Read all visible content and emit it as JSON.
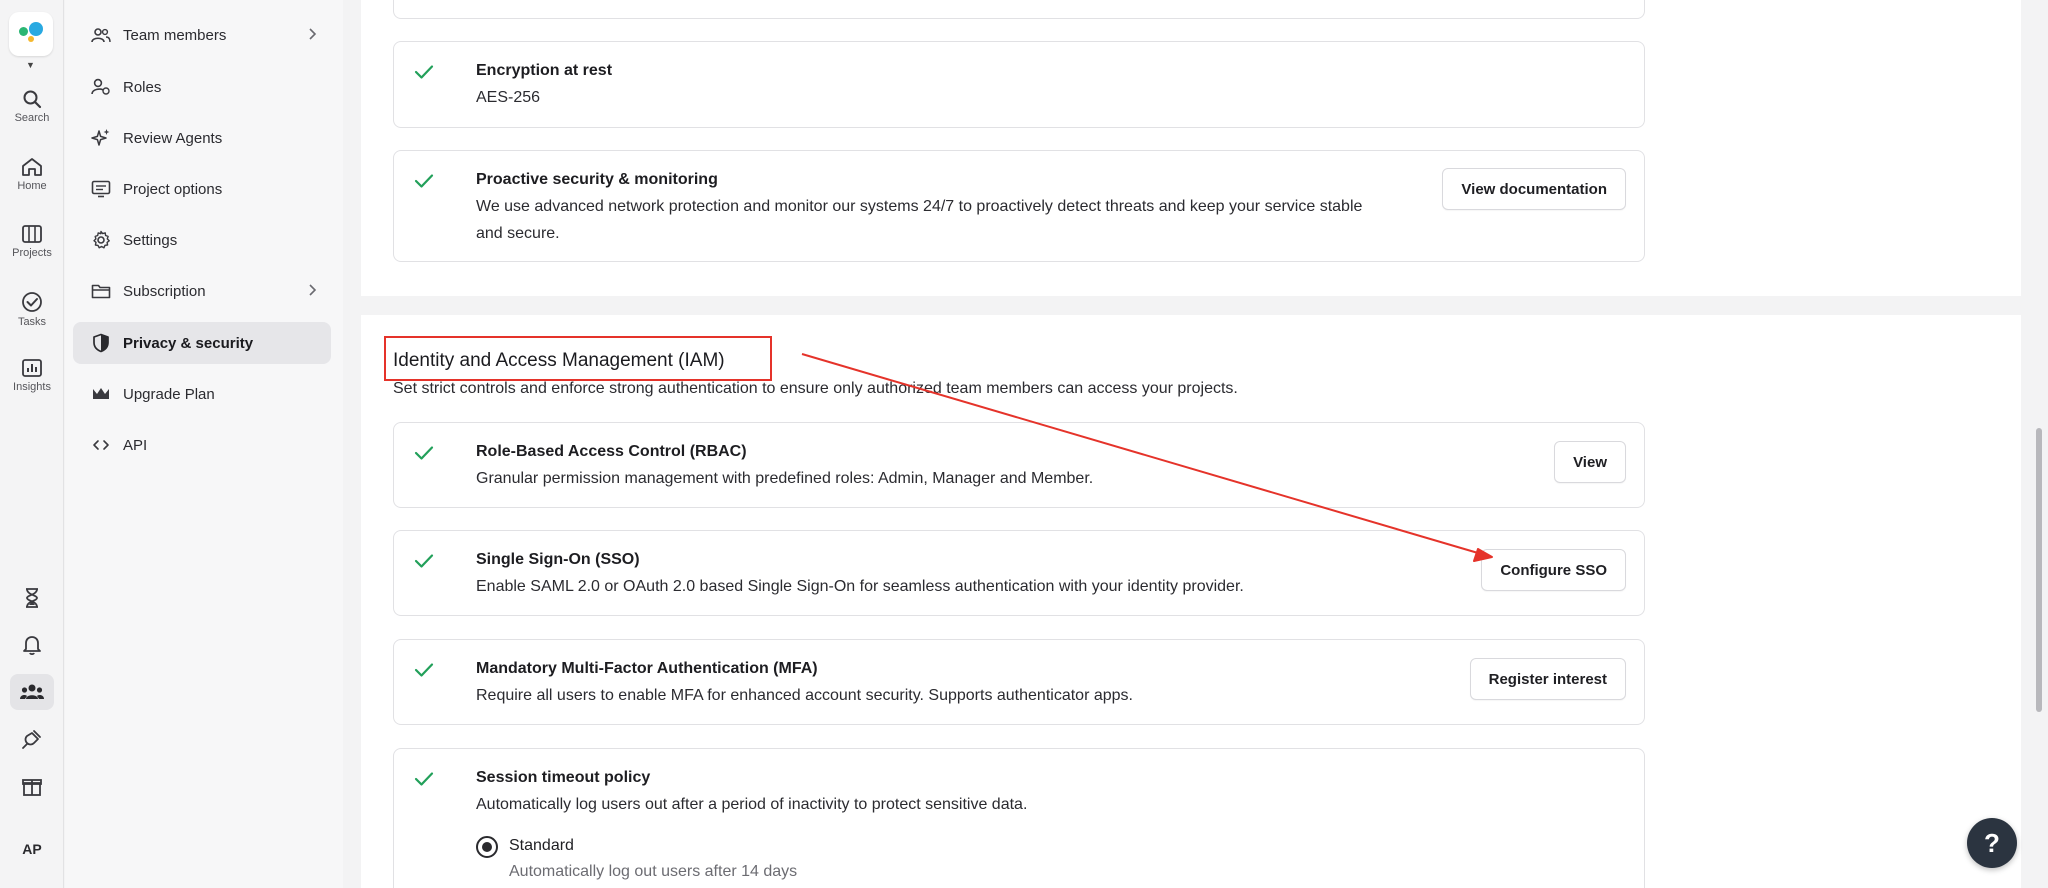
{
  "rail": {
    "items": [
      {
        "label": "Search",
        "icon": "search-icon"
      },
      {
        "label": "Home",
        "icon": "home-icon"
      },
      {
        "label": "Projects",
        "icon": "projects-icon"
      },
      {
        "label": "Tasks",
        "icon": "tasks-icon"
      },
      {
        "label": "Insights",
        "icon": "insights-icon"
      }
    ],
    "avatar": "AP"
  },
  "nav": {
    "items": [
      {
        "label": "Team members",
        "icon": "team-icon",
        "has_chevron": true
      },
      {
        "label": "Roles",
        "icon": "roles-icon"
      },
      {
        "label": "Review Agents",
        "icon": "sparkle-icon"
      },
      {
        "label": "Project options",
        "icon": "project-options-icon"
      },
      {
        "label": "Settings",
        "icon": "gear-icon"
      },
      {
        "label": "Subscription",
        "icon": "folder-icon",
        "has_chevron": true
      },
      {
        "label": "Privacy & security",
        "icon": "shield-icon",
        "active": true
      },
      {
        "label": "Upgrade Plan",
        "icon": "crown-icon"
      },
      {
        "label": "API",
        "icon": "code-icon"
      }
    ]
  },
  "security": {
    "encryption": {
      "title": "Encryption at rest",
      "desc": "AES-256"
    },
    "proactive": {
      "title": "Proactive security & monitoring",
      "desc_line1": "We use advanced network protection and monitor our systems 24/7 to proactively detect threats and keep your service stable",
      "desc_line2": "and secure.",
      "button": "View documentation"
    }
  },
  "iam": {
    "title": "Identity and Access Management (IAM)",
    "subtitle": "Set strict controls and enforce strong authentication to ensure only authorized team members can access your projects.",
    "rbac": {
      "title": "Role-Based Access Control (RBAC)",
      "desc": "Granular permission management with predefined roles: Admin, Manager and Member.",
      "button": "View"
    },
    "sso": {
      "title": "Single Sign-On (SSO)",
      "desc": "Enable SAML 2.0 or OAuth 2.0 based Single Sign-On for seamless authentication with your identity provider.",
      "button": "Configure SSO"
    },
    "mfa": {
      "title": "Mandatory Multi-Factor Authentication (MFA)",
      "desc": "Require all users to enable MFA for enhanced account security. Supports authenticator apps.",
      "button": "Register interest"
    },
    "session": {
      "title": "Session timeout policy",
      "desc": "Automatically log users out after a period of inactivity to protect sensitive data.",
      "option_label": "Standard",
      "option_desc": "Automatically log out users after 14 days"
    }
  },
  "help": {
    "label": "?"
  },
  "colors": {
    "check": "#22a05a",
    "annotation": "#e5332a",
    "help_bg": "#2b3440"
  }
}
